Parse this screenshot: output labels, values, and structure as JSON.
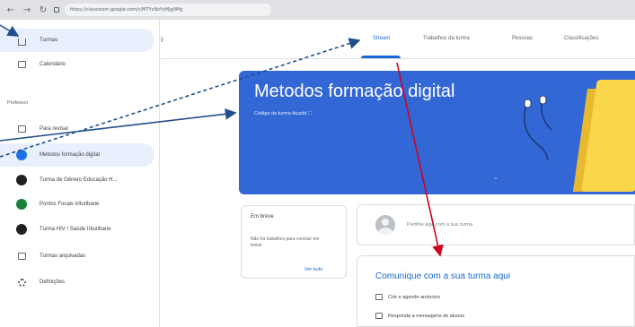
{
  "browser": {
    "url": "https://classroom.google.com/c/MTYxNzYyMjg0Mg"
  },
  "sidebar": {
    "items": [
      {
        "label": "Turmas",
        "icon": "home-icon"
      },
      {
        "label": "Calendário",
        "icon": "calendar-icon"
      }
    ],
    "teaching_label": "Professor",
    "teaching": [
      {
        "label": "Para revisar",
        "icon": "folder-icon"
      },
      {
        "label": "Metodos formação digital",
        "avatar_color": "#1a73e8",
        "selected": true
      },
      {
        "label": "Turma de Gênero Educação H...",
        "avatar_color": "#202124"
      },
      {
        "label": "Pontos Focais Irituribane",
        "avatar_color": "#188038"
      },
      {
        "label": "Turma HIV / Saúde Irituribane",
        "avatar_color": "#202124"
      }
    ],
    "bottom": [
      {
        "label": "Turmas arquivadas",
        "icon": "archive-icon"
      },
      {
        "label": "Definições",
        "icon": "gear-icon"
      }
    ]
  },
  "tabs": [
    {
      "label": "Stream",
      "active": true
    },
    {
      "label": "Trabalhos da turma"
    },
    {
      "label": "Pessoas"
    },
    {
      "label": "Classificações"
    }
  ],
  "banner": {
    "title": "Metodos formação digital",
    "code_label": "Código da turma",
    "code_value": "tkuzdd",
    "code_icon": "fullscreen-icon",
    "color": "#3367d6"
  },
  "upcoming": {
    "title": "Em breve",
    "body": "Não há trabalhos para concluir em breve",
    "link": "Ver tudo"
  },
  "announce": {
    "placeholder": "Partilhe algo com a sua turma"
  },
  "communicate": {
    "title": "Comunique com a sua turma aqui",
    "rows": [
      {
        "label": "Crie e agende anúncios",
        "icon": "announcement-icon"
      },
      {
        "label": "Responda a mensagens de alunos",
        "icon": "reply-icon"
      }
    ]
  },
  "colors": {
    "accent": "#1967d2",
    "annotation_arrow": "#1f4e8c",
    "red_arrow": "#d0021b"
  }
}
